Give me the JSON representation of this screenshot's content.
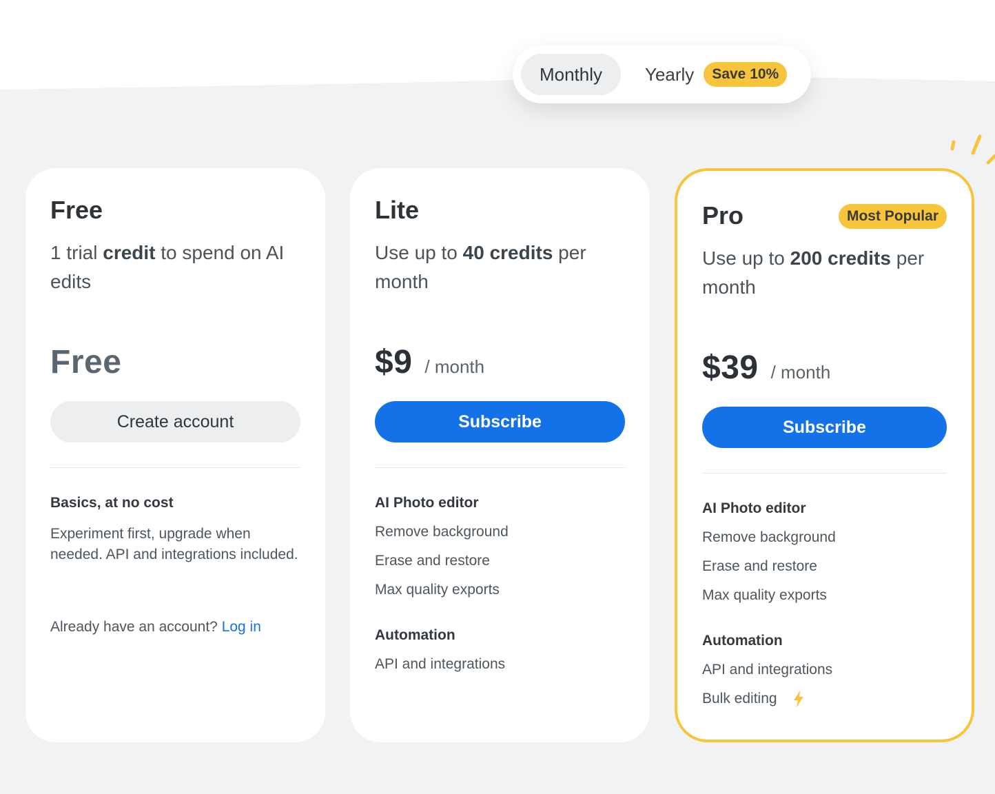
{
  "billing_toggle": {
    "monthly_label": "Monthly",
    "yearly_label": "Yearly",
    "save_badge": "Save 10%"
  },
  "colors": {
    "accent_blue": "#1472e8",
    "accent_yellow": "#f7c53c",
    "background": "#f1f2f4"
  },
  "plans": [
    {
      "name": "Free",
      "desc_pre": "1 trial ",
      "desc_bold": "credit",
      "desc_post": " to spend on AI edits",
      "price": "Free",
      "button": "Create account",
      "section_title": "Basics, at no cost",
      "section_text": "Experiment first, upgrade when needed. API and integrations included.",
      "already_text": "Already have an account?",
      "login_link": "Log in"
    },
    {
      "name": "Lite",
      "desc_pre": "Use up to ",
      "desc_bold": "40 credits",
      "desc_post": " per month",
      "price": "$9",
      "per": "/ month",
      "button": "Subscribe",
      "sections": [
        {
          "title": "AI Photo editor",
          "features": [
            "Remove background",
            "Erase and restore",
            "Max quality exports"
          ]
        },
        {
          "title": "Automation",
          "features": [
            "API and integrations"
          ]
        }
      ]
    },
    {
      "name": "Pro",
      "badge": "Most Popular",
      "desc_pre": "Use up to ",
      "desc_bold": "200 credits",
      "desc_post": " per month",
      "price": "$39",
      "per": "/ month",
      "button": "Subscribe",
      "sections": [
        {
          "title": "AI Photo editor",
          "features": [
            "Remove background",
            "Erase and restore",
            "Max quality exports"
          ]
        },
        {
          "title": "Automation",
          "features": [
            "API and integrations",
            "Bulk editing"
          ]
        }
      ],
      "bulk_icon": "lightning-bolt-icon"
    }
  ]
}
